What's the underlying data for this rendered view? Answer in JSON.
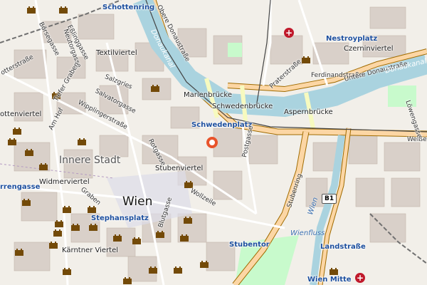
{
  "labels": {
    "schottenring": "Schottenring",
    "obere_donaustrasse": "Obere Donaustraße",
    "donaukanal_1": "Donaukanal",
    "donaukanal_2": "Donaukanal",
    "nestroyplatz": "Nestroyplatz",
    "czerninviertel": "Czerninviertel",
    "esslinggasse": "Eßlinggasse",
    "borsegasse": "Börsegasse",
    "neutorgasse": "Neutorgasse",
    "textilviertel": "Textilviertel",
    "praterstrasse": "Praterstraße",
    "ferdinandstrasse": "Ferdinandstraße",
    "untere_donaustrasse": "Untere Donaustraße",
    "marienbrucke": "Marienbrücke",
    "schwedenbrucke": "Schwedenbrücke",
    "aspernbrucke": "Aspernbrücke",
    "salzgries": "Salzgries",
    "tiefer_graben": "Tiefer Graben",
    "salvatorgasse": "Salvatorgasse",
    "wipplingerstrasse": "Wipplingerstraße",
    "am_hof": "Am Hof",
    "rotgasse": "Rotgasse",
    "schwedenplatz": "Schwedenplatz",
    "postgasse": "Postgasse",
    "weiss": "Weiße",
    "lowengasse": "Löwengasse",
    "innere_stadt": "Innere Stadt",
    "stubenviertel": "Stubenviertel",
    "herrengasse": "rrengasse",
    "widmerviertel": "Widmerviertel",
    "graben": "Graben",
    "wien": "Wien",
    "wollzeile": "Wollzeile",
    "stubenring": "Stubenring",
    "wien_fluss_1": "Wien",
    "wien_fluss_2": "Wienfluss",
    "stephansplatz": "Stephansplatz",
    "blutgasse": "Blutgasse",
    "karntner_viertel": "Kärntner Viertel",
    "stubentor": "Stubentor",
    "landstrasse": "Landstraße",
    "wien_mitte": "Wien Mitte",
    "ottenviertel": "ottenviertel",
    "schottenstrasse": "otterstraße",
    "b1": "B1"
  },
  "colors": {
    "land": "#f2efe9",
    "built": "#d9d0c9",
    "water": "#aad3df",
    "primary_road": "#fcd6a4",
    "primary_road_casing": "#a06b00",
    "secondary_road": "#f7fabf",
    "park": "#c8facc",
    "pedestrian": "#dddde8",
    "railway": "#707070",
    "tram": "#444444",
    "marker": "#e8532b",
    "poi": "#734a08",
    "hospital": "#c0192b"
  },
  "icons": {
    "attraction": "castle-icon",
    "hospital": "hospital-cross-icon",
    "location": "location-marker-icon"
  }
}
